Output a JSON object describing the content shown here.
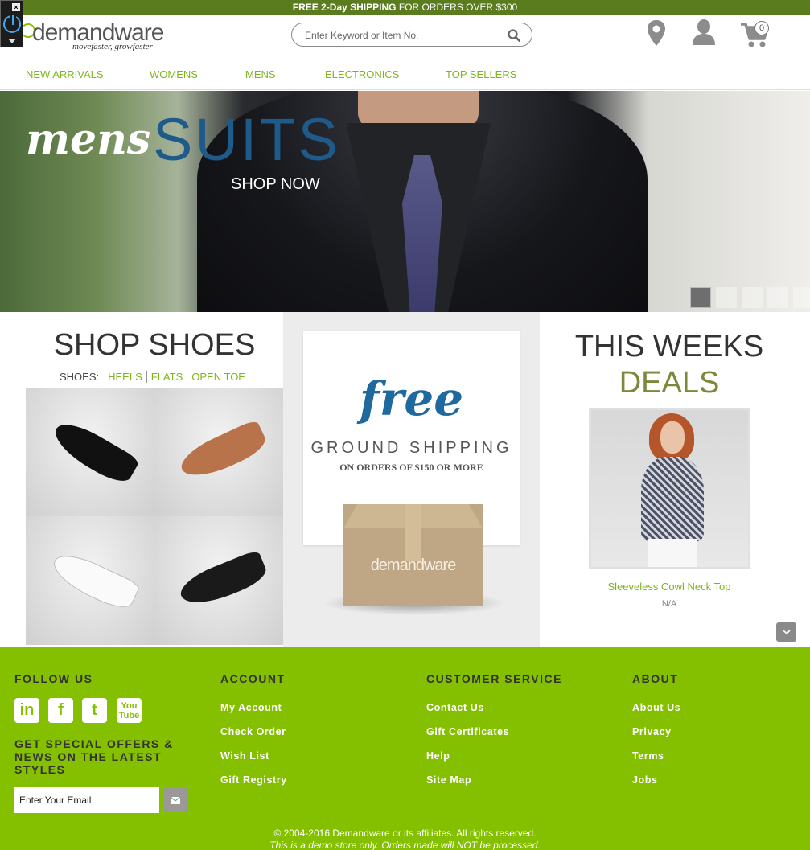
{
  "promo": {
    "bold": "FREE 2-Day SHIPPING",
    "rest": " FOR ORDERS OVER $300"
  },
  "logo": {
    "name": "demandware",
    "tagline": "movefaster, growfaster"
  },
  "search": {
    "placeholder": "Enter Keyword or Item No."
  },
  "cart": {
    "count": "0"
  },
  "nav": {
    "items": [
      "NEW ARRIVALS",
      "WOMENS",
      "MENS",
      "ELECTRONICS",
      "TOP SELLERS"
    ]
  },
  "hero": {
    "title_italic": "mens",
    "title_caps": "SUITS",
    "cta": "SHOP NOW",
    "slides": 5,
    "active_slide": 1
  },
  "shoes": {
    "title": "SHOP SHOES",
    "label": "SHOES:",
    "links": [
      "HEELS",
      "FLATS",
      "OPEN TOE"
    ]
  },
  "shipping": {
    "free": "free",
    "ground": "GROUND SHIPPING",
    "orders": "ON ORDERS OF $150 OR MORE",
    "box_label": "demandware"
  },
  "deals": {
    "title_line1": "THIS WEEKS",
    "title_line2": "DEALS",
    "product_name": "Sleeveless Cowl Neck Top",
    "price": "N/A"
  },
  "footer": {
    "follow": "FOLLOW US",
    "social": [
      "linkedin-icon",
      "facebook-icon",
      "twitter-icon",
      "youtube-icon"
    ],
    "offers": "GET SPECIAL OFFERS & NEWS ON THE LATEST STYLES",
    "email_value": "Enter Your Email",
    "account": {
      "head": "ACCOUNT",
      "links": [
        "My Account",
        "Check Order",
        "Wish List",
        "Gift Registry"
      ]
    },
    "service": {
      "head": "CUSTOMER SERVICE",
      "links": [
        "Contact Us",
        "Gift Certificates",
        "Help",
        "Site Map"
      ]
    },
    "about": {
      "head": "ABOUT",
      "links": [
        "About Us",
        "Privacy",
        "Terms",
        "Jobs"
      ]
    },
    "copyright": "© 2004-2016 Demandware or its affiliates. All rights reserved.",
    "demo_note": "This is a demo store only. Orders made will NOT be processed."
  },
  "colors": {
    "brand_green": "#84bf00",
    "link_green": "#7fb51b",
    "promo_bg": "#5a7c1e",
    "shipping_blue": "#1e6a9e"
  }
}
